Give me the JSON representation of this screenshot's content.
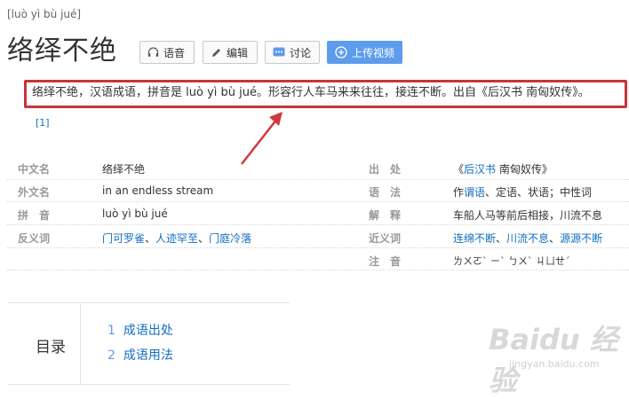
{
  "header": {
    "pinyin": "[luò yì bù jué]",
    "title": "络绎不绝",
    "buttons": {
      "voice": "语音",
      "edit": "编辑",
      "discuss": "讨论",
      "upload": "上传视频"
    }
  },
  "summary": {
    "text": "络绎不绝，汉语成语，拼音是 luò yì bù jué。形容行人车马来来往往，接连不断。出自《后汉书 南匈奴传》。",
    "ref": "[1]"
  },
  "info": {
    "left": [
      {
        "label": "中文名",
        "value": "络绎不绝"
      },
      {
        "label": "外文名",
        "value": "in an endless stream"
      },
      {
        "label": "拼　音",
        "value": "luò yì bù jué"
      },
      {
        "label": "反义词",
        "links": [
          "门可罗雀",
          "人迹罕至",
          "门庭冷落"
        ]
      }
    ],
    "right": [
      {
        "label": "出　处",
        "value_prefix": "《",
        "link": "后汉书",
        "value_suffix": " 南匈奴传》"
      },
      {
        "label": "语　法",
        "value_prefix": "作",
        "link": "谓语",
        "value_suffix": "、定语、状语；中性词"
      },
      {
        "label": "解　释",
        "value": "车船人马等前后相接，川流不息"
      },
      {
        "label": "近义词",
        "links": [
          "连绵不断",
          "川流不息",
          "源源不断"
        ]
      },
      {
        "label": "注　音",
        "value": "ㄌㄨㄛˋ ㄧˋ ㄅㄨˋ ㄐㄩㄝˊ"
      }
    ]
  },
  "toc": {
    "title": "目录",
    "items": [
      {
        "num": "1",
        "label": "成语出处"
      },
      {
        "num": "2",
        "label": "成语用法"
      }
    ]
  },
  "watermark": {
    "brand": "Baidu 经验",
    "url": "jingyan.baidu.com"
  },
  "colors": {
    "link": "#136ec2",
    "highlight": "#c8343a",
    "upload_button": "#5d9cec"
  }
}
